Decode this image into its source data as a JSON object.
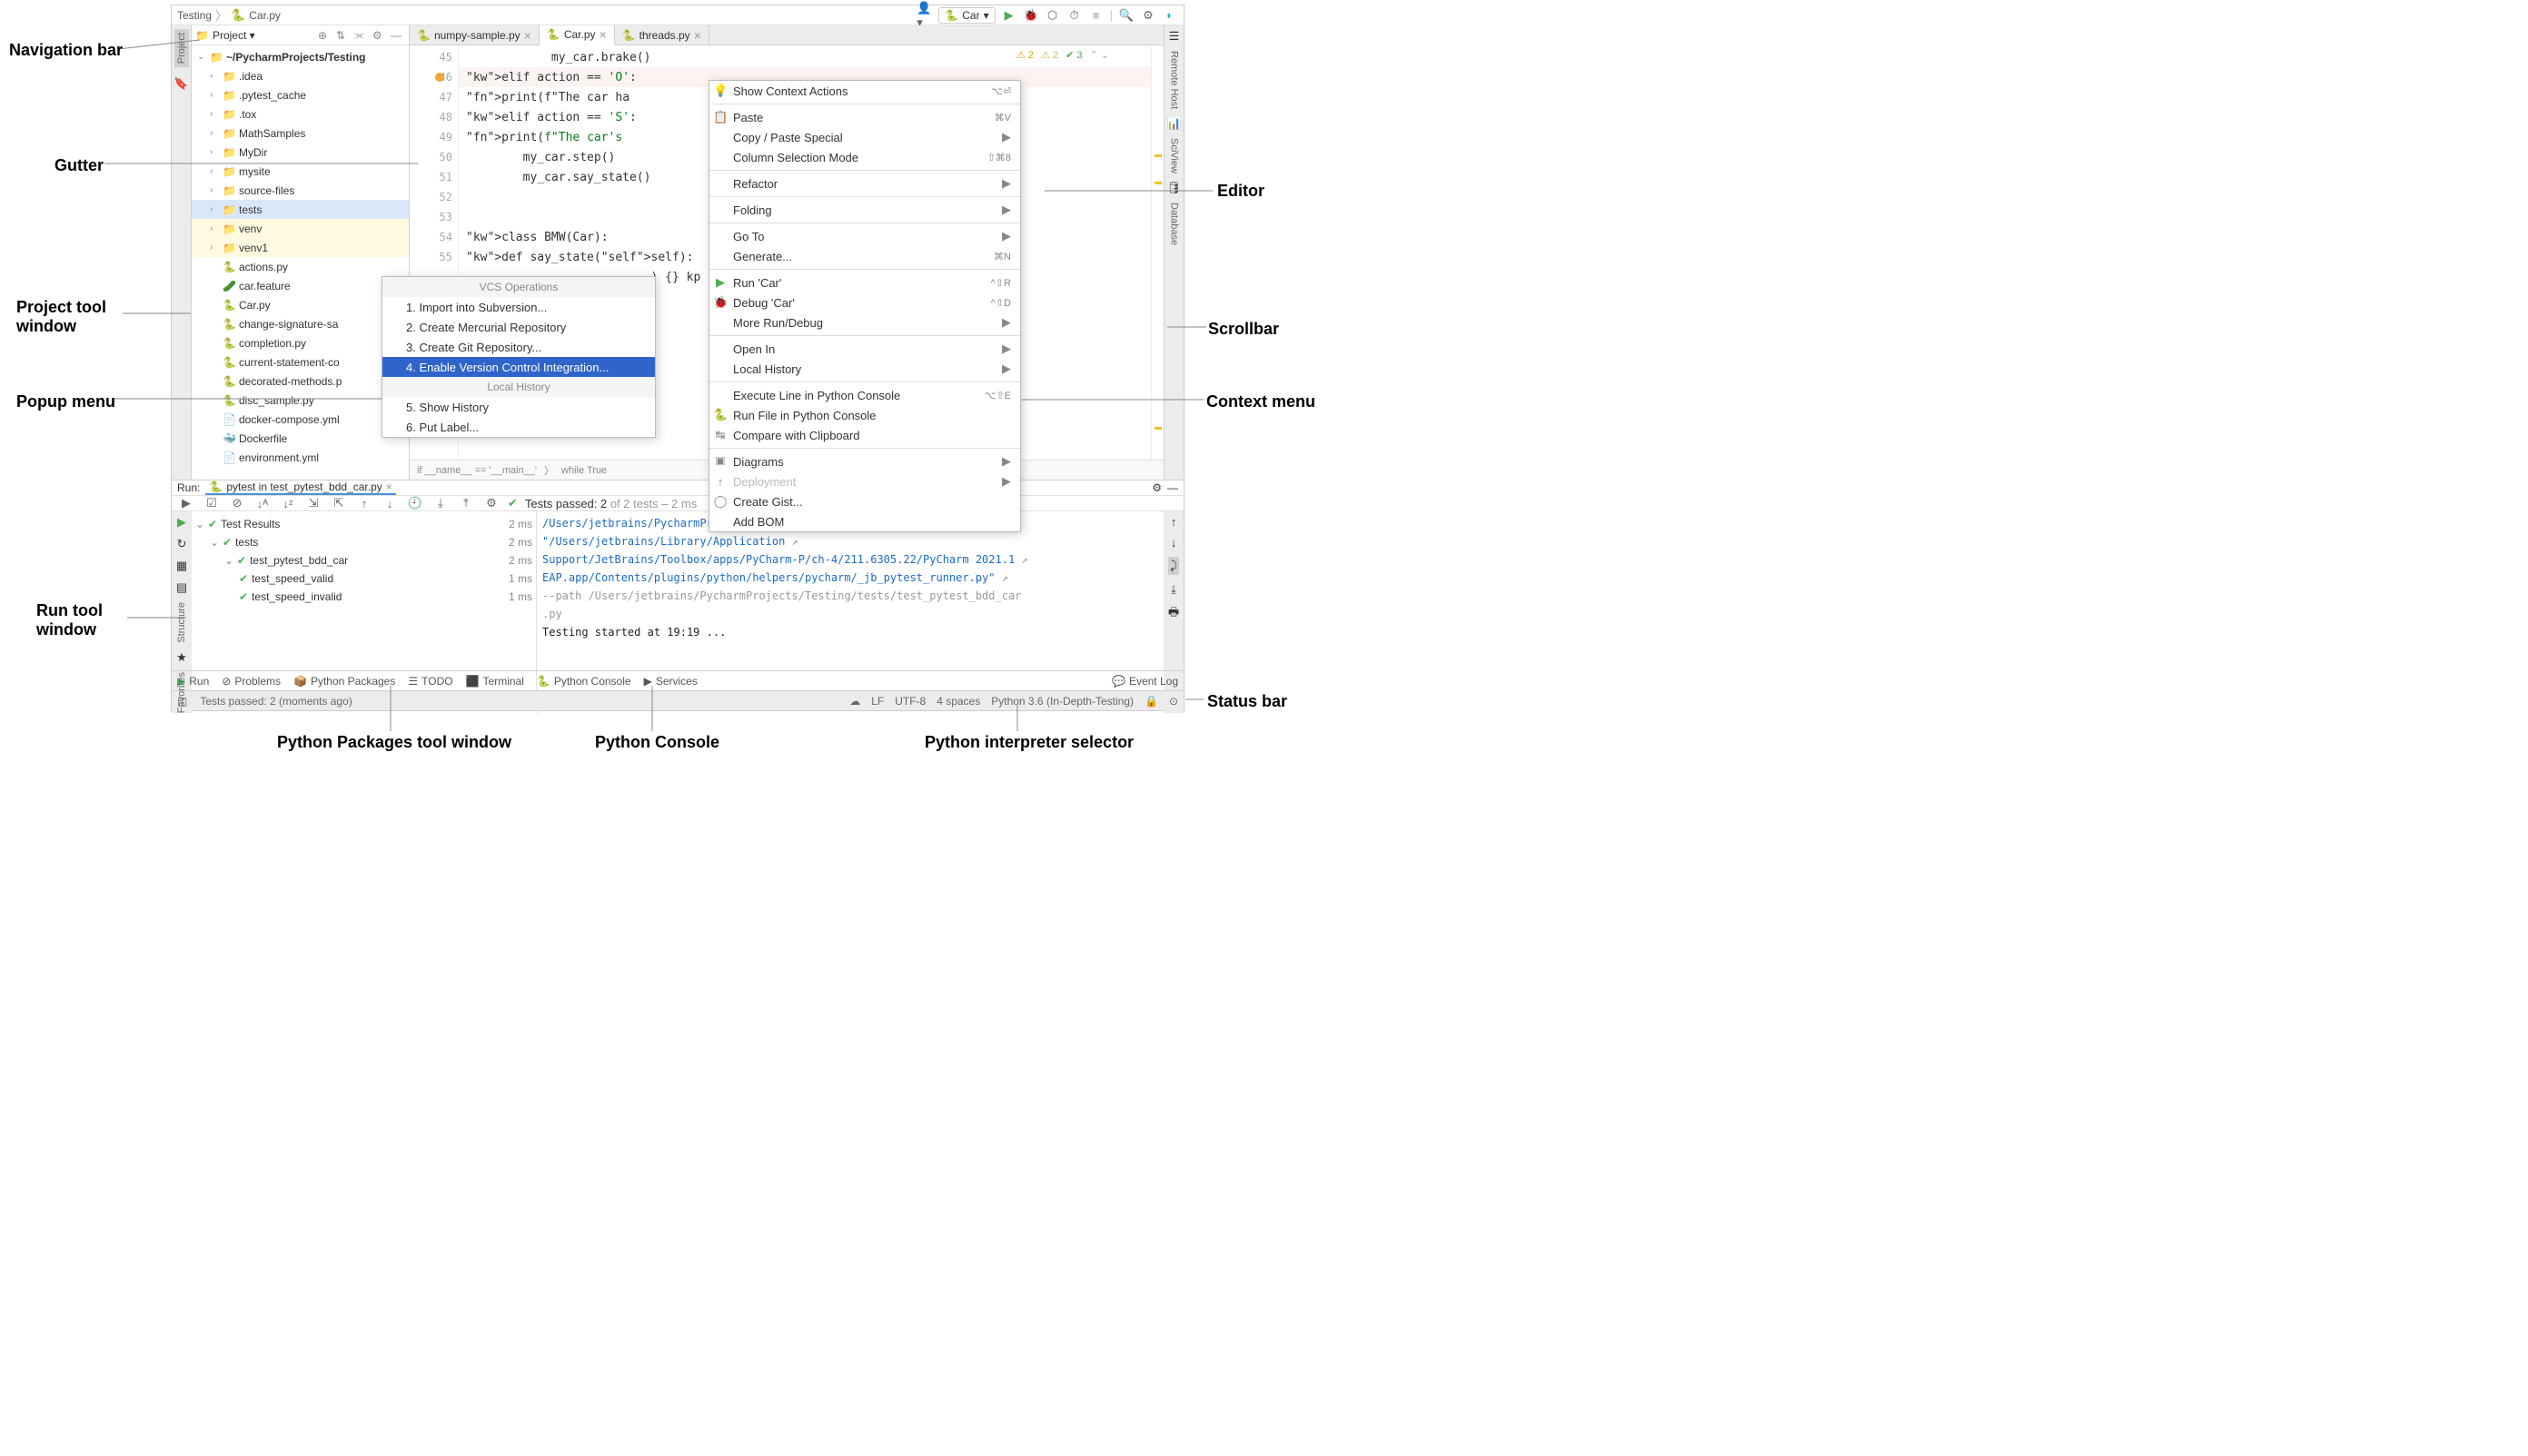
{
  "navbar": {
    "breadcrumb": [
      "Testing",
      "Car.py"
    ],
    "run_config": "Car"
  },
  "annotations": {
    "nav_bar": "Navigation bar",
    "gutter": "Gutter",
    "project_tool": "Project tool window",
    "popup": "Popup menu",
    "run_tool": "Run tool window",
    "editor": "Editor",
    "scrollbar": "Scrollbar",
    "context": "Context menu",
    "status": "Status bar",
    "py_packages": "Python Packages tool window",
    "py_console": "Python Console",
    "interpreter": "Python interpreter selector"
  },
  "project": {
    "header": "Project  ▾",
    "root": "~/PycharmProjects/Testing",
    "items": [
      {
        "label": ".idea",
        "type": "folder",
        "indent": 1
      },
      {
        "label": ".pytest_cache",
        "type": "folder",
        "indent": 1
      },
      {
        "label": ".tox",
        "type": "folder",
        "indent": 1
      },
      {
        "label": "MathSamples",
        "type": "folder",
        "indent": 1
      },
      {
        "label": "MyDir",
        "type": "folder",
        "indent": 1
      },
      {
        "label": "mysite",
        "type": "folder",
        "indent": 1
      },
      {
        "label": "source-files",
        "type": "folder-blue",
        "indent": 1
      },
      {
        "label": "tests",
        "type": "folder-blue",
        "indent": 1,
        "sel": true
      },
      {
        "label": "venv",
        "type": "folder-orange",
        "indent": 1,
        "venv": true
      },
      {
        "label": "venv1",
        "type": "folder-orange",
        "indent": 1,
        "venv": true
      },
      {
        "label": "actions.py",
        "type": "py",
        "indent": 1
      },
      {
        "label": "car.feature",
        "type": "feat",
        "indent": 1
      },
      {
        "label": "Car.py",
        "type": "py",
        "indent": 1
      },
      {
        "label": "change-signature-sa",
        "type": "py",
        "indent": 1
      },
      {
        "label": "completion.py",
        "type": "py",
        "indent": 1
      },
      {
        "label": "current-statement-co",
        "type": "py",
        "indent": 1
      },
      {
        "label": "decorated-methods.p",
        "type": "py",
        "indent": 1
      },
      {
        "label": "disc_sample.py",
        "type": "py",
        "indent": 1
      },
      {
        "label": "docker-compose.yml",
        "type": "yml",
        "indent": 1
      },
      {
        "label": "Dockerfile",
        "type": "docker",
        "indent": 1
      },
      {
        "label": "environment.yml",
        "type": "yml",
        "indent": 1
      }
    ]
  },
  "tabs": [
    {
      "label": "numpy-sample.py",
      "active": false
    },
    {
      "label": "Car.py",
      "active": true
    },
    {
      "label": "threads.py",
      "active": false
    }
  ],
  "inspections": {
    "warn": "2",
    "weak": "2",
    "ok": "3"
  },
  "gutter_lines": [
    "45",
    "46",
    "47",
    "48",
    "49",
    "50",
    "51",
    "52",
    "53",
    "54",
    "55",
    "",
    "",
    "",
    "",
    "",
    "",
    "",
    ""
  ],
  "bp_line": 1,
  "code": [
    {
      "t": "            my_car.brake()"
    },
    {
      "t": "        elif action == 'O':",
      "hl": true
    },
    {
      "t": "            print(f\"The car ha"
    },
    {
      "t": "        elif action == 'S':"
    },
    {
      "t": "            print(f\"The car's                                  kph\")"
    },
    {
      "t": "        my_car.step()"
    },
    {
      "t": "        my_car.say_state()"
    },
    {
      "t": ""
    },
    {
      "t": ""
    },
    {
      "t": "class BMW(Car):"
    },
    {
      "t": "    def say_state(self):"
    },
    {
      "t": "                          ) {} kp"
    },
    {
      "t": ""
    },
    {
      "t": ""
    },
    {
      "t": ""
    },
    {
      "t": ""
    },
    {
      "t": ""
    },
    {
      "t": ""
    },
    {
      "t": ""
    }
  ],
  "breadcrumb_editor": [
    "if __name__ == '__main__'",
    "while True"
  ],
  "popup": {
    "header": "VCS Operations",
    "items": [
      "1. Import into Subversion...",
      "2. Create Mercurial Repository",
      "3. Create Git Repository...",
      "4. Enable Version Control Integration..."
    ],
    "sel_index": 3,
    "section2_header": "Local History",
    "section2": [
      "5. Show History",
      "6. Put Label..."
    ]
  },
  "context": [
    {
      "label": "Show Context Actions",
      "short": "⌥⏎",
      "icn": "💡"
    },
    {
      "sep": true
    },
    {
      "label": "Paste",
      "short": "⌘V",
      "icn": "📋"
    },
    {
      "label": "Copy / Paste Special",
      "arrow": true
    },
    {
      "label": "Column Selection Mode",
      "short": "⇧⌘8"
    },
    {
      "sep": true
    },
    {
      "label": "Refactor",
      "arrow": true
    },
    {
      "sep": true
    },
    {
      "label": "Folding",
      "arrow": true
    },
    {
      "sep": true
    },
    {
      "label": "Go To",
      "arrow": true
    },
    {
      "label": "Generate...",
      "short": "⌘N"
    },
    {
      "sep": true
    },
    {
      "label": "Run 'Car'",
      "short": "^⇧R",
      "icn": "▶",
      "icnColor": "#4caf50"
    },
    {
      "label": "Debug 'Car'",
      "short": "^⇧D",
      "icn": "🐞",
      "icnColor": "#4caf50"
    },
    {
      "label": "More Run/Debug",
      "arrow": true
    },
    {
      "sep": true
    },
    {
      "label": "Open In",
      "arrow": true
    },
    {
      "label": "Local History",
      "arrow": true
    },
    {
      "sep": true
    },
    {
      "label": "Execute Line in Python Console",
      "short": "⌥⇧E"
    },
    {
      "label": "Run File in Python Console",
      "icn": "🐍"
    },
    {
      "label": "Compare with Clipboard",
      "icn": "↹"
    },
    {
      "sep": true
    },
    {
      "label": "Diagrams",
      "arrow": true,
      "icn": "🞕"
    },
    {
      "label": "Deployment",
      "arrow": true,
      "disabled": true,
      "icn": "↑"
    },
    {
      "label": "Create Gist...",
      "icn": "◯"
    },
    {
      "label": "Add BOM"
    }
  ],
  "run": {
    "label": "Run:",
    "tab": "pytest in test_pytest_bdd_car.py",
    "tests_passed": "Tests passed: 2",
    "tests_total": " of 2 tests – 2 ms",
    "tree": [
      {
        "label": "Test Results",
        "indent": 0,
        "time": "2 ms",
        "check": true,
        "open": true
      },
      {
        "label": "tests",
        "indent": 1,
        "time": "2 ms",
        "check": true,
        "open": true
      },
      {
        "label": "test_pytest_bdd_car",
        "indent": 2,
        "time": "2 ms",
        "check": true,
        "open": true
      },
      {
        "label": "test_speed_valid",
        "indent": 3,
        "time": "1 ms",
        "check": true
      },
      {
        "label": "test_speed_invalid",
        "indent": 3,
        "time": "1 ms",
        "check": true
      }
    ],
    "console": [
      {
        "t": "/Users/jetbrains/PycharmProjects/In-Depth-Testing/venv/bin/python",
        "link": true
      },
      {
        "t": "\"/Users/jetbrains/Library/Application",
        "link": true
      },
      {
        "t": "Support/JetBrains/Toolbox/apps/PyCharm-P/ch-4/211.6305.22/PyCharm 2021.1",
        "link": true
      },
      {
        "t": "EAP.app/Contents/plugins/python/helpers/pycharm/_jb_pytest_runner.py\"",
        "link": true
      },
      {
        "t": "--path /Users/jetbrains/PycharmProjects/Testing/tests/test_pytest_bdd_car",
        "gray": true
      },
      {
        "t": ".py",
        "gray": true
      },
      {
        "t": "Testing started at 19:19 ..."
      }
    ]
  },
  "bottom": {
    "items": [
      "Run",
      "Problems",
      "Python Packages",
      "TODO",
      "Terminal",
      "Python Console",
      "Services"
    ],
    "event_log": "Event Log"
  },
  "status": {
    "left": "Tests passed: 2 (moments ago)",
    "right": [
      "LF",
      "UTF-8",
      "4 spaces",
      "Python 3.6 (In-Depth-Testing)"
    ]
  },
  "right_tools": [
    "Remote Host",
    "SciView",
    "Database"
  ],
  "left_tools": [
    "Project"
  ],
  "left_bottom_tools": [
    "Structure",
    "Favorites"
  ]
}
